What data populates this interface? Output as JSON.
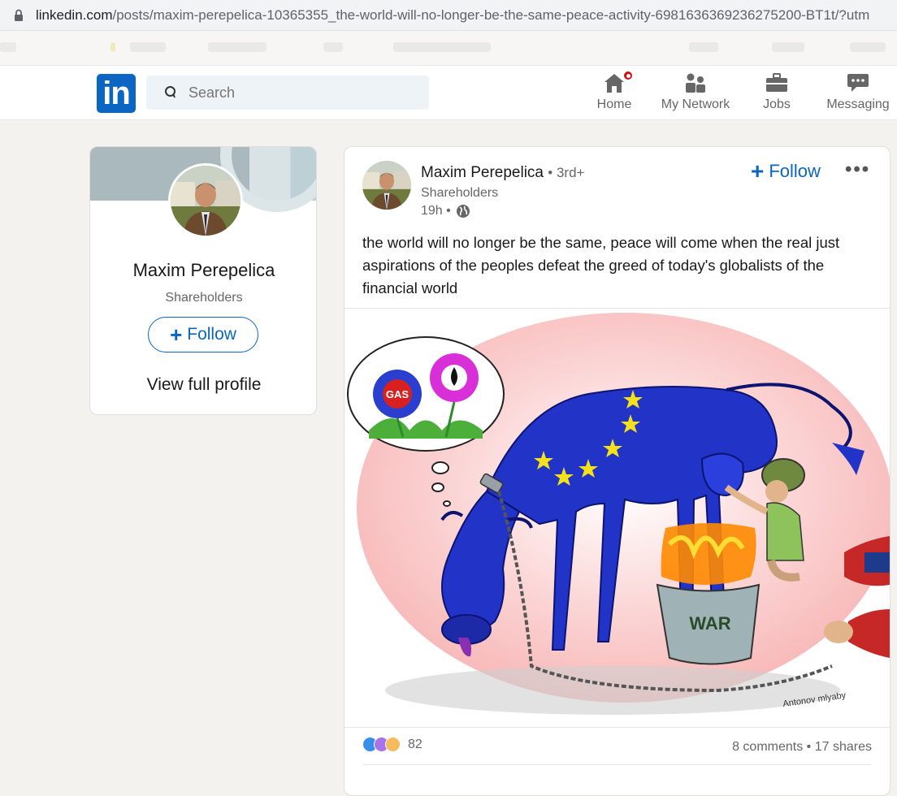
{
  "browser": {
    "url_host": "linkedin.com",
    "url_path": "/posts/maxim-perepelica-10365355_the-world-will-no-longer-be-the-same-peace-activity-6981636369236275200-BT1t/?utm"
  },
  "nav": {
    "logo": "in",
    "search_placeholder": "Search",
    "items": [
      {
        "label": "Home",
        "icon": "home-icon"
      },
      {
        "label": "My Network",
        "icon": "network-icon"
      },
      {
        "label": "Jobs",
        "icon": "briefcase-icon"
      },
      {
        "label": "Messaging",
        "icon": "messaging-icon"
      }
    ]
  },
  "profile_card": {
    "name": "Maxim Perepelica",
    "headline": "Shareholders",
    "follow_label": "Follow",
    "view_profile_label": "View full profile"
  },
  "post": {
    "author": "Maxim Perepelica",
    "degree": "• 3rd+",
    "headline": "Shareholders",
    "time": "19h •",
    "follow_label": "Follow",
    "more_label": "•••",
    "text": "the world will no longer be the same, peace will come when the real just aspirations of the peoples defeat the greed of today's globalists of the financial world",
    "image": {
      "bubble_label": "GAS",
      "bucket_label": "WAR",
      "signature": "Antonov mlyaby"
    },
    "reaction_count": "82",
    "comments": "8 comments",
    "separator": "•",
    "shares": "17 shares"
  },
  "colors": {
    "brand": "#0a66c2",
    "notification": "#cc1016",
    "page_bg": "#f3f2ef"
  }
}
